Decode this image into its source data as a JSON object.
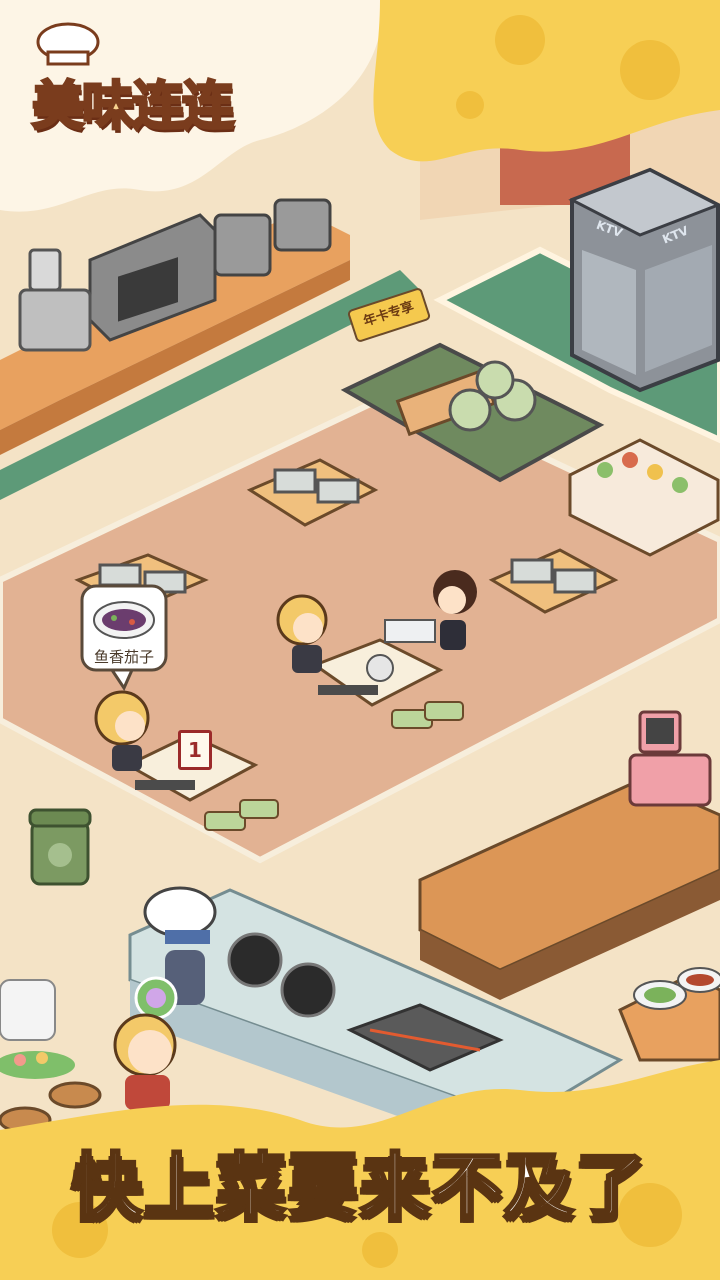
{
  "app": {
    "logo_text": "美味连连"
  },
  "banner": {
    "slogan": "快上菜要来不及了"
  },
  "scene": {
    "vip_area_label": "年卡专享",
    "ktv_booth": {
      "label_left": "KTV",
      "label_right": "KTV"
    },
    "order_bubble": {
      "dish_name": "鱼香茄子",
      "icon": "eggplant-dish-icon"
    },
    "table_number": "1"
  },
  "colors": {
    "cheese": "#f7cf55",
    "floor_carpet": "#e2b293",
    "floor_tile": "#f4e3c6",
    "brick": "#c8694f",
    "green_mat": "#5d9a78",
    "text_outline": "#5a3412"
  }
}
